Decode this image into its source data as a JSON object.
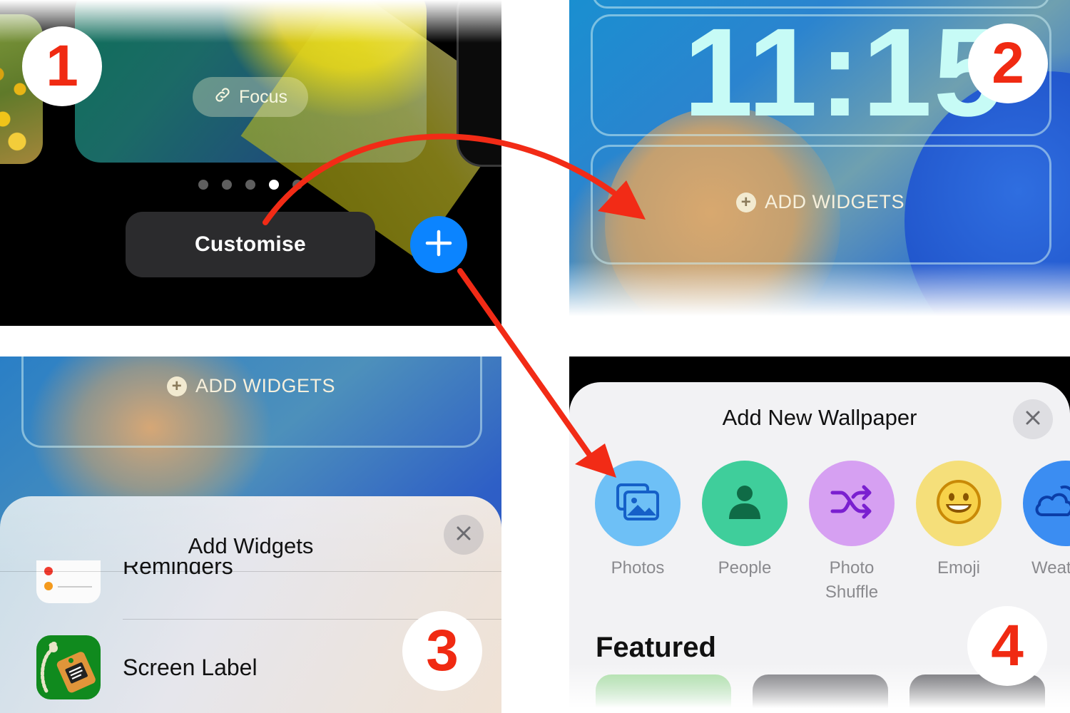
{
  "steps": [
    "1",
    "2",
    "3",
    "4"
  ],
  "panel1": {
    "focus_label": "Focus",
    "page_dots": {
      "count": 5,
      "active_index": 3
    },
    "customise_label": "Customise",
    "add_button_icon": "plus-icon",
    "focus_icon": "link-icon"
  },
  "panel2": {
    "time": "11:15",
    "add_widgets_label": "ADD WIDGETS",
    "add_icon": "plus-circle-icon"
  },
  "panel3": {
    "add_widgets_label": "ADD WIDGETS",
    "sheet_title": "Add Widgets",
    "close_icon": "close-icon",
    "list": [
      {
        "label": "Reminders",
        "icon": "reminders-app-icon"
      },
      {
        "label": "Screen Label",
        "icon": "screen-label-app-icon"
      }
    ]
  },
  "panel4": {
    "sheet_title": "Add New Wallpaper",
    "close_icon": "close-icon",
    "options": [
      {
        "label": "Photos",
        "icon": "photos-icon",
        "color": "#6ec0f6"
      },
      {
        "label": "People",
        "icon": "person-icon",
        "color": "#3fce9b"
      },
      {
        "label": "Photo\nShuffle",
        "icon": "shuffle-icon",
        "color": "#d6a0f2"
      },
      {
        "label": "Emoji",
        "icon": "emoji-icon",
        "color": "#f5df7a"
      },
      {
        "label": "Weat",
        "icon": "weather-icon",
        "color": "#3b8df2"
      }
    ],
    "featured_label": "Featured"
  },
  "colors": {
    "accent_blue": "#0b84ff",
    "step_red": "#f02a12",
    "arrow_red": "#f22b16"
  }
}
